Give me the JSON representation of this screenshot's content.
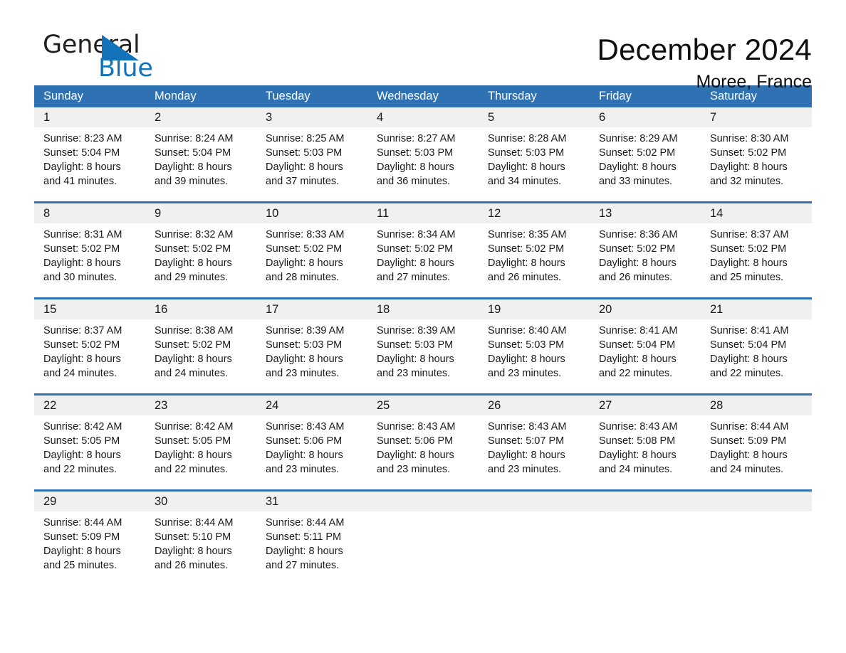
{
  "brand": {
    "name_part1": "General",
    "name_part2": "Blue",
    "triangle_color": "#1373ba"
  },
  "header": {
    "title": "December 2024",
    "subtitle": "Moree, France"
  },
  "theme": {
    "header_blue": "#2f72b4",
    "row_rule_blue": "#2f72b4",
    "daynum_band": "#f0f0f0",
    "text": "#1a1a1a"
  },
  "calendar": {
    "weekday_headers": [
      "Sunday",
      "Monday",
      "Tuesday",
      "Wednesday",
      "Thursday",
      "Friday",
      "Saturday"
    ],
    "weeks": [
      [
        {
          "day": "1",
          "sunrise": "Sunrise: 8:23 AM",
          "sunset": "Sunset: 5:04 PM",
          "daylight1": "Daylight: 8 hours",
          "daylight2": "and 41 minutes."
        },
        {
          "day": "2",
          "sunrise": "Sunrise: 8:24 AM",
          "sunset": "Sunset: 5:04 PM",
          "daylight1": "Daylight: 8 hours",
          "daylight2": "and 39 minutes."
        },
        {
          "day": "3",
          "sunrise": "Sunrise: 8:25 AM",
          "sunset": "Sunset: 5:03 PM",
          "daylight1": "Daylight: 8 hours",
          "daylight2": "and 37 minutes."
        },
        {
          "day": "4",
          "sunrise": "Sunrise: 8:27 AM",
          "sunset": "Sunset: 5:03 PM",
          "daylight1": "Daylight: 8 hours",
          "daylight2": "and 36 minutes."
        },
        {
          "day": "5",
          "sunrise": "Sunrise: 8:28 AM",
          "sunset": "Sunset: 5:03 PM",
          "daylight1": "Daylight: 8 hours",
          "daylight2": "and 34 minutes."
        },
        {
          "day": "6",
          "sunrise": "Sunrise: 8:29 AM",
          "sunset": "Sunset: 5:02 PM",
          "daylight1": "Daylight: 8 hours",
          "daylight2": "and 33 minutes."
        },
        {
          "day": "7",
          "sunrise": "Sunrise: 8:30 AM",
          "sunset": "Sunset: 5:02 PM",
          "daylight1": "Daylight: 8 hours",
          "daylight2": "and 32 minutes."
        }
      ],
      [
        {
          "day": "8",
          "sunrise": "Sunrise: 8:31 AM",
          "sunset": "Sunset: 5:02 PM",
          "daylight1": "Daylight: 8 hours",
          "daylight2": "and 30 minutes."
        },
        {
          "day": "9",
          "sunrise": "Sunrise: 8:32 AM",
          "sunset": "Sunset: 5:02 PM",
          "daylight1": "Daylight: 8 hours",
          "daylight2": "and 29 minutes."
        },
        {
          "day": "10",
          "sunrise": "Sunrise: 8:33 AM",
          "sunset": "Sunset: 5:02 PM",
          "daylight1": "Daylight: 8 hours",
          "daylight2": "and 28 minutes."
        },
        {
          "day": "11",
          "sunrise": "Sunrise: 8:34 AM",
          "sunset": "Sunset: 5:02 PM",
          "daylight1": "Daylight: 8 hours",
          "daylight2": "and 27 minutes."
        },
        {
          "day": "12",
          "sunrise": "Sunrise: 8:35 AM",
          "sunset": "Sunset: 5:02 PM",
          "daylight1": "Daylight: 8 hours",
          "daylight2": "and 26 minutes."
        },
        {
          "day": "13",
          "sunrise": "Sunrise: 8:36 AM",
          "sunset": "Sunset: 5:02 PM",
          "daylight1": "Daylight: 8 hours",
          "daylight2": "and 26 minutes."
        },
        {
          "day": "14",
          "sunrise": "Sunrise: 8:37 AM",
          "sunset": "Sunset: 5:02 PM",
          "daylight1": "Daylight: 8 hours",
          "daylight2": "and 25 minutes."
        }
      ],
      [
        {
          "day": "15",
          "sunrise": "Sunrise: 8:37 AM",
          "sunset": "Sunset: 5:02 PM",
          "daylight1": "Daylight: 8 hours",
          "daylight2": "and 24 minutes."
        },
        {
          "day": "16",
          "sunrise": "Sunrise: 8:38 AM",
          "sunset": "Sunset: 5:02 PM",
          "daylight1": "Daylight: 8 hours",
          "daylight2": "and 24 minutes."
        },
        {
          "day": "17",
          "sunrise": "Sunrise: 8:39 AM",
          "sunset": "Sunset: 5:03 PM",
          "daylight1": "Daylight: 8 hours",
          "daylight2": "and 23 minutes."
        },
        {
          "day": "18",
          "sunrise": "Sunrise: 8:39 AM",
          "sunset": "Sunset: 5:03 PM",
          "daylight1": "Daylight: 8 hours",
          "daylight2": "and 23 minutes."
        },
        {
          "day": "19",
          "sunrise": "Sunrise: 8:40 AM",
          "sunset": "Sunset: 5:03 PM",
          "daylight1": "Daylight: 8 hours",
          "daylight2": "and 23 minutes."
        },
        {
          "day": "20",
          "sunrise": "Sunrise: 8:41 AM",
          "sunset": "Sunset: 5:04 PM",
          "daylight1": "Daylight: 8 hours",
          "daylight2": "and 22 minutes."
        },
        {
          "day": "21",
          "sunrise": "Sunrise: 8:41 AM",
          "sunset": "Sunset: 5:04 PM",
          "daylight1": "Daylight: 8 hours",
          "daylight2": "and 22 minutes."
        }
      ],
      [
        {
          "day": "22",
          "sunrise": "Sunrise: 8:42 AM",
          "sunset": "Sunset: 5:05 PM",
          "daylight1": "Daylight: 8 hours",
          "daylight2": "and 22 minutes."
        },
        {
          "day": "23",
          "sunrise": "Sunrise: 8:42 AM",
          "sunset": "Sunset: 5:05 PM",
          "daylight1": "Daylight: 8 hours",
          "daylight2": "and 22 minutes."
        },
        {
          "day": "24",
          "sunrise": "Sunrise: 8:43 AM",
          "sunset": "Sunset: 5:06 PM",
          "daylight1": "Daylight: 8 hours",
          "daylight2": "and 23 minutes."
        },
        {
          "day": "25",
          "sunrise": "Sunrise: 8:43 AM",
          "sunset": "Sunset: 5:06 PM",
          "daylight1": "Daylight: 8 hours",
          "daylight2": "and 23 minutes."
        },
        {
          "day": "26",
          "sunrise": "Sunrise: 8:43 AM",
          "sunset": "Sunset: 5:07 PM",
          "daylight1": "Daylight: 8 hours",
          "daylight2": "and 23 minutes."
        },
        {
          "day": "27",
          "sunrise": "Sunrise: 8:43 AM",
          "sunset": "Sunset: 5:08 PM",
          "daylight1": "Daylight: 8 hours",
          "daylight2": "and 24 minutes."
        },
        {
          "day": "28",
          "sunrise": "Sunrise: 8:44 AM",
          "sunset": "Sunset: 5:09 PM",
          "daylight1": "Daylight: 8 hours",
          "daylight2": "and 24 minutes."
        }
      ],
      [
        {
          "day": "29",
          "sunrise": "Sunrise: 8:44 AM",
          "sunset": "Sunset: 5:09 PM",
          "daylight1": "Daylight: 8 hours",
          "daylight2": "and 25 minutes."
        },
        {
          "day": "30",
          "sunrise": "Sunrise: 8:44 AM",
          "sunset": "Sunset: 5:10 PM",
          "daylight1": "Daylight: 8 hours",
          "daylight2": "and 26 minutes."
        },
        {
          "day": "31",
          "sunrise": "Sunrise: 8:44 AM",
          "sunset": "Sunset: 5:11 PM",
          "daylight1": "Daylight: 8 hours",
          "daylight2": "and 27 minutes."
        },
        {
          "day": "",
          "sunrise": "",
          "sunset": "",
          "daylight1": "",
          "daylight2": ""
        },
        {
          "day": "",
          "sunrise": "",
          "sunset": "",
          "daylight1": "",
          "daylight2": ""
        },
        {
          "day": "",
          "sunrise": "",
          "sunset": "",
          "daylight1": "",
          "daylight2": ""
        },
        {
          "day": "",
          "sunrise": "",
          "sunset": "",
          "daylight1": "",
          "daylight2": ""
        }
      ]
    ]
  }
}
